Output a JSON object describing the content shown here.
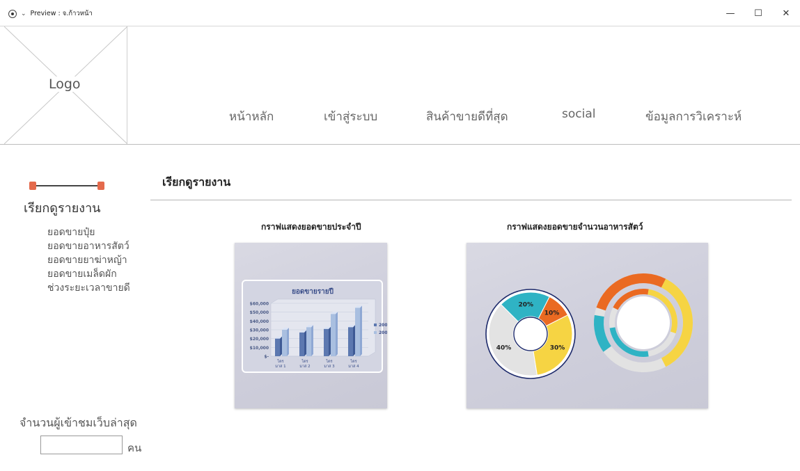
{
  "window": {
    "title": "Preview : จ.ก้าวหน้า",
    "minimize_glyph": "—",
    "maximize_glyph": "☐",
    "close_glyph": "✕"
  },
  "logo": {
    "text": "Logo"
  },
  "nav": {
    "items": [
      {
        "label": "หน้าหลัก"
      },
      {
        "label": "เข้าสู่ระบบ"
      },
      {
        "label": "สินค้าขายดีที่สุด"
      },
      {
        "label": "social"
      },
      {
        "label": "ข้อมูลการวิเคราะห์"
      }
    ]
  },
  "sidebar": {
    "title": "เรียกดูรายงาน",
    "items": [
      {
        "label": "ยอดขายปุ๋ย"
      },
      {
        "label": "ยอดขายอาหารสัตว์"
      },
      {
        "label": "ยอดขายยาฆ่าหญ้า"
      },
      {
        "label": "ยอดขายเมล็ดผัก"
      },
      {
        "label": "ช่วงระยะเวลาขายดี"
      }
    ],
    "visitors_label": "จำนวนผู้เข้าชมเว็บล่าสุด",
    "visitors_value": "",
    "visitors_unit": "คน"
  },
  "main": {
    "title": "เรียกดูรายงาน",
    "left_chart_title": "กราฟแสดงยอดขายประจำปี",
    "right_chart_title": "กราฟแสดงยอดขายจำนวนอาหารสัตว์"
  },
  "chart_data": [
    {
      "type": "bar",
      "title": "ยอดขายรายปี",
      "categories": [
        "ไตร มาส 1",
        "ไตร มาส 2",
        "ไตร มาส 3",
        "ไตร มาส 4"
      ],
      "series": [
        {
          "name": "2004",
          "values": [
            20000,
            27000,
            31000,
            33000
          ]
        },
        {
          "name": "2005",
          "values": [
            30000,
            33000,
            48000,
            55000
          ]
        }
      ],
      "yticks": [
        "$60,000",
        "$50,000",
        "$40,000",
        "$30,000",
        "$20,000",
        "$10,000",
        "$-"
      ],
      "ylim": [
        0,
        60000
      ],
      "legend": "right",
      "colors": {
        "2004": "#5c78b0",
        "2005": "#a9bfe0"
      }
    },
    {
      "type": "pie",
      "slices": [
        {
          "label": "20%",
          "value": 20,
          "color": "#2fb3c4"
        },
        {
          "label": "10%",
          "value": 10,
          "color": "#ea6a22"
        },
        {
          "label": "30%",
          "value": 30,
          "color": "#f6d443"
        },
        {
          "label": "40%",
          "value": 40,
          "color": "#e3e3e3"
        }
      ]
    }
  ]
}
